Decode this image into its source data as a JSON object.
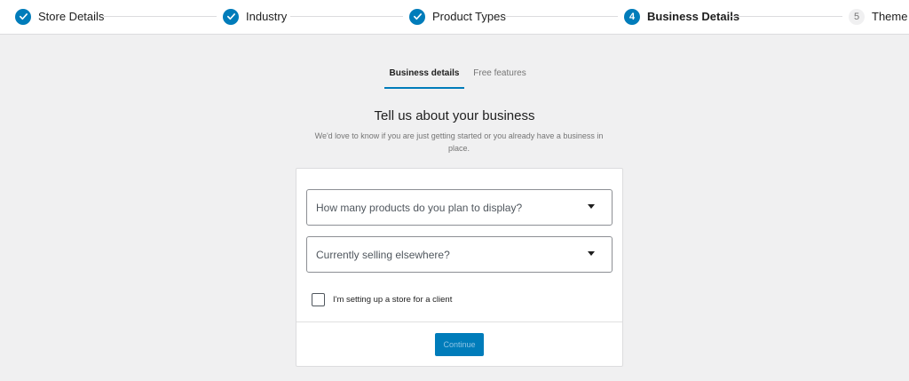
{
  "stepper": {
    "steps": [
      {
        "label": "Store Details",
        "state": "done"
      },
      {
        "label": "Industry",
        "state": "done"
      },
      {
        "label": "Product Types",
        "state": "done"
      },
      {
        "label": "Business Details",
        "state": "current",
        "number": "4"
      },
      {
        "label": "Theme",
        "state": "pending",
        "number": "5"
      }
    ]
  },
  "tabs": [
    {
      "label": "Business details",
      "active": true
    },
    {
      "label": "Free features",
      "active": false
    }
  ],
  "main": {
    "title": "Tell us about your business",
    "subtitle": "We'd love to know if you are just getting started or you already have a business in place."
  },
  "form": {
    "products_select": {
      "placeholder": "How many products do you plan to display?"
    },
    "selling_select": {
      "placeholder": "Currently selling elsewhere?"
    },
    "client_checkbox": {
      "label": "I'm setting up a store for a client",
      "checked": false
    },
    "continue_label": "Continue"
  },
  "colors": {
    "accent": "#007cba",
    "background": "#f0f0f1",
    "card": "#ffffff"
  },
  "icons": {
    "done_step": "checkmark-icon",
    "select_caret": "caret-down-icon"
  }
}
